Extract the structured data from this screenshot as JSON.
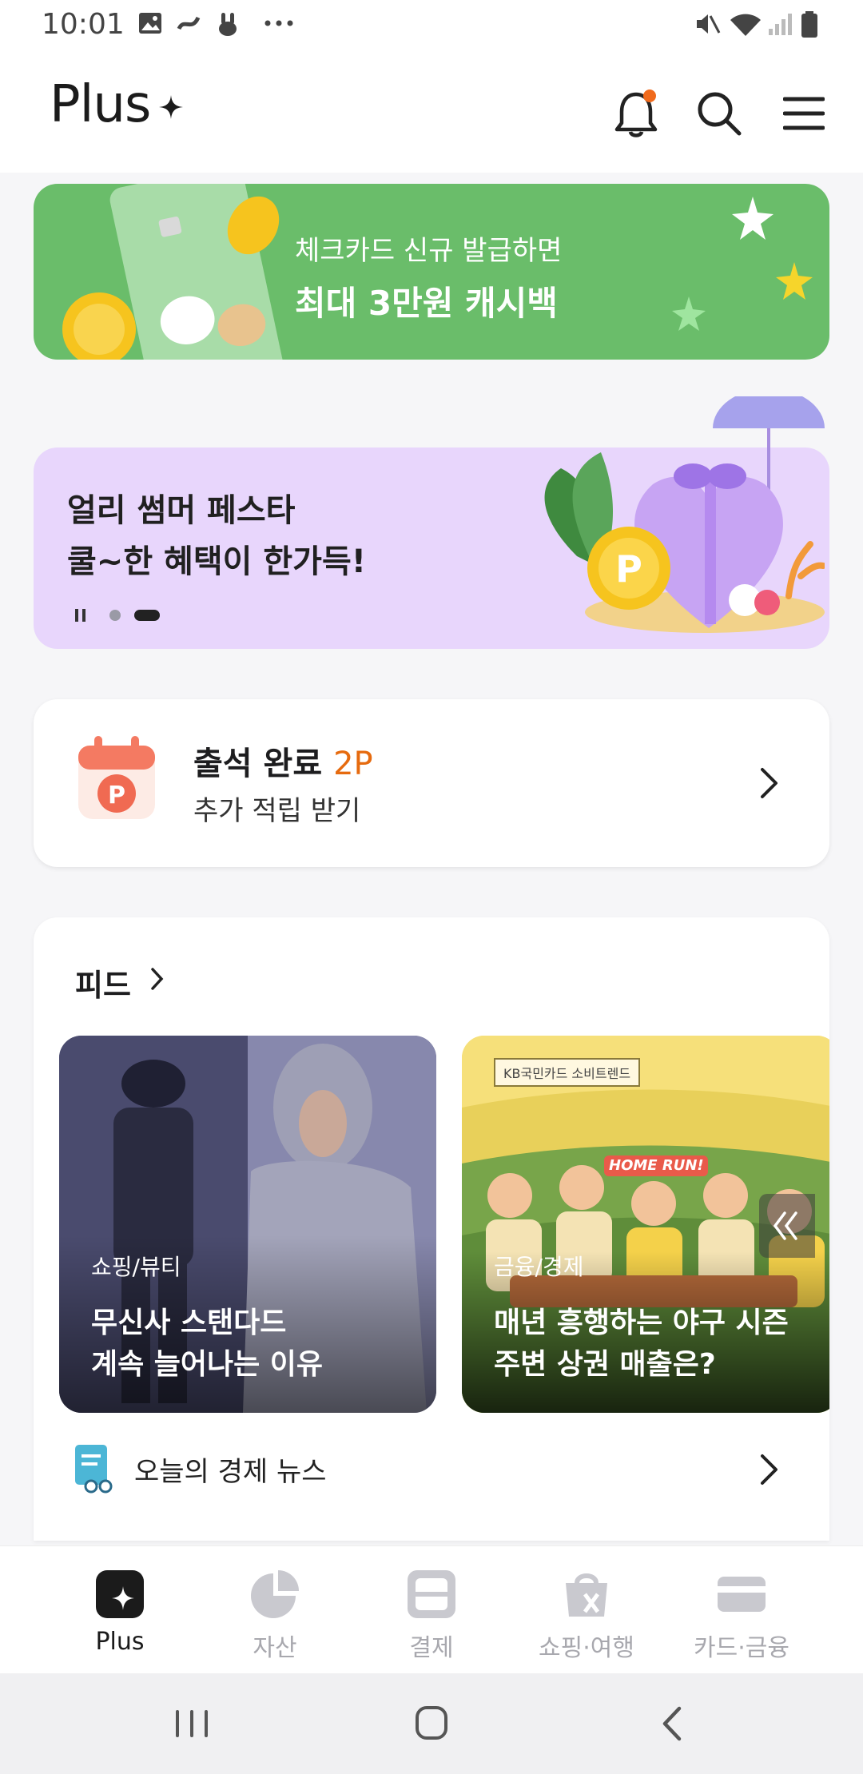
{
  "status_bar": {
    "time": "10:01"
  },
  "header": {
    "title": "Plus"
  },
  "banner_green": {
    "line1": "체크카드 신규 발급하면",
    "line2": "최대 3만원 캐시백",
    "color": "#6abd6a"
  },
  "banner_purple": {
    "line1": "얼리 썸머 페스타",
    "line2": "쿨~한 혜택이 한가득!",
    "color": "#e8d6fc"
  },
  "attendance": {
    "title": "출석 완료 ",
    "points": "2P",
    "subtitle": "추가 적립 받기",
    "accent": "#e66a0e"
  },
  "feed": {
    "title": "피드",
    "items": [
      {
        "category": "쇼핑/뷰티",
        "headline1": "무신사 스탠다드",
        "headline2": "계속 늘어나는 이유"
      },
      {
        "category": "금융/경제",
        "headline1": "매년 흥행하는 야구 시즌",
        "headline2": "주변 상권 매출은?",
        "sticker": "KB국민카드 소비트렌드",
        "banner_text": "HOME RUN!"
      }
    ],
    "news_row": "오늘의 경제 뉴스"
  },
  "bottom_nav": {
    "items": [
      {
        "label": "Plus",
        "icon": "plus-sparkle-icon",
        "active": true
      },
      {
        "label": "자산",
        "icon": "pie-chart-icon",
        "active": false
      },
      {
        "label": "결제",
        "icon": "scan-pay-icon",
        "active": false
      },
      {
        "label": "쇼핑·여행",
        "icon": "shopping-bag-icon",
        "active": false
      },
      {
        "label": "카드·금융",
        "icon": "card-icon",
        "active": false
      }
    ]
  }
}
